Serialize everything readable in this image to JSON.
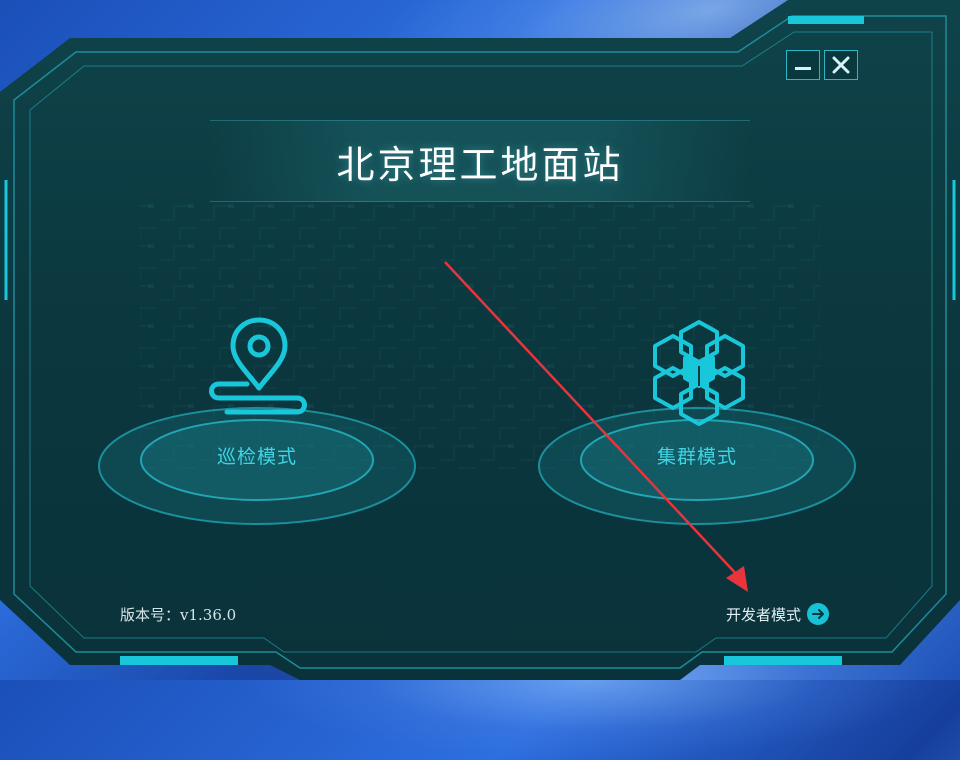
{
  "app": {
    "title": "北京理工地面站"
  },
  "window_controls": {
    "minimize_icon": "minimize-icon",
    "close_icon": "close-icon"
  },
  "modes": [
    {
      "label": "巡检模式",
      "icon": "location-pin-route-icon"
    },
    {
      "label": "集群模式",
      "icon": "hexagon-cluster-icon"
    }
  ],
  "footer": {
    "version": "版本号：v1.36.0",
    "developer_mode": "开发者模式",
    "developer_mode_icon": "arrow-right-circle-icon"
  },
  "colors": {
    "panel": "#0c3a41",
    "accent": "#17c2d6",
    "title": "#ffffff",
    "annotation_arrow": "#e8343c"
  }
}
